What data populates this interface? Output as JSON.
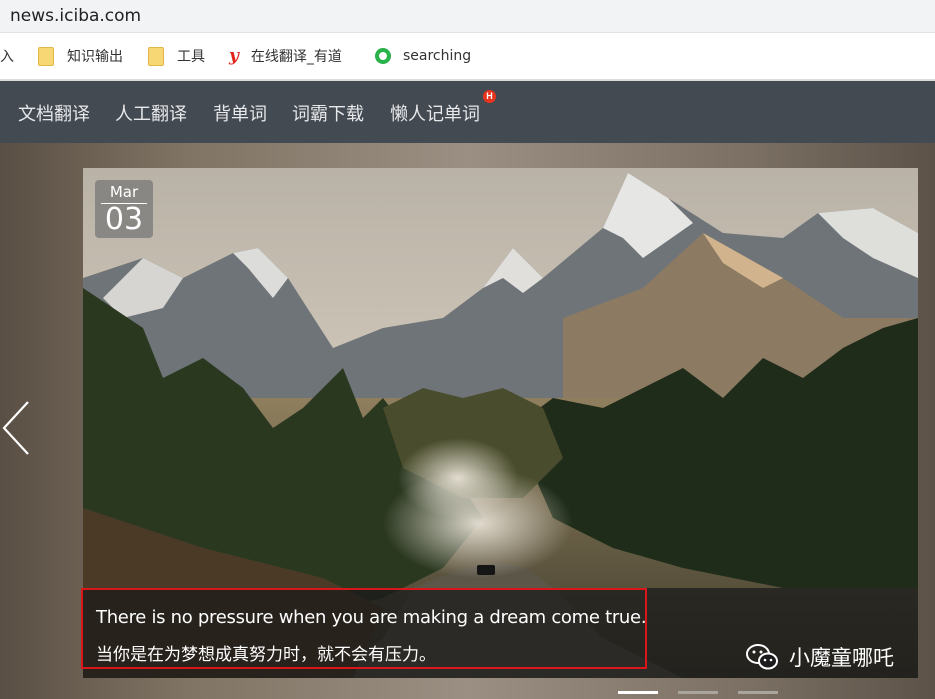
{
  "browser": {
    "url": "news.iciba.com",
    "bookmarks": [
      {
        "label": "入",
        "icon": "none"
      },
      {
        "label": "知识输出",
        "icon": "folder-icon"
      },
      {
        "label": "工具",
        "icon": "folder-icon"
      },
      {
        "label": "在线翻译_有道",
        "icon": "youdao-icon"
      },
      {
        "label": "searching",
        "icon": "qiangguo-icon"
      }
    ]
  },
  "nav": {
    "items": [
      "文档翻译",
      "人工翻译",
      "背单词",
      "词霸下载",
      "懒人记单词"
    ],
    "badge": "H"
  },
  "slide": {
    "month": "Mar",
    "day": "03",
    "quote_en": "There is no pressure when you are making a dream come true.",
    "quote_zh": "当你是在为梦想成真努力时，就不会有压力。",
    "watermark": "小魔童哪吒",
    "active_index": 0,
    "total": 3
  },
  "colors": {
    "nav_bg": "#444a52",
    "highlight_border": "#d9171b",
    "badge": "#e8341c"
  }
}
